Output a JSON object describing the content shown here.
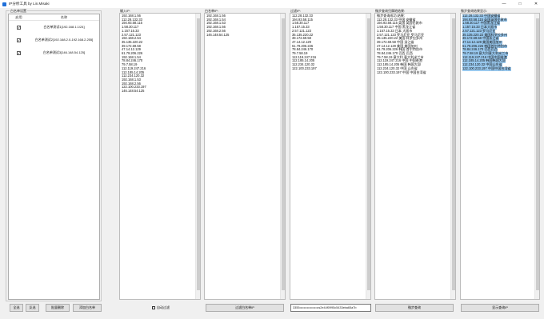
{
  "window": {
    "title": "IP分析工具 by Lin.Misaki",
    "controls": [
      "—",
      "□",
      "✕"
    ]
  },
  "whitelist": {
    "group_title": "白名单设置",
    "columns": [
      "启用",
      "名称"
    ],
    "rows": [
      {
        "checked": true,
        "name": "白名单测试1[192.168.1.1/24]"
      },
      {
        "checked": true,
        "name": "白名单测试2[192.168.2.0-192.168.2.255]"
      },
      {
        "checked": true,
        "name": "白名单测试3[146.148.54.125]"
      }
    ],
    "buttons": [
      "全选",
      "反选",
      "批量删除",
      "添加白名单"
    ]
  },
  "input_panel": {
    "label": "输入IP:",
    "lines": [
      "192.168.1.56",
      "112.28.132.33",
      "194.93.58.115",
      "1.58.30.117",
      "1.157.15.33",
      "2.57.121.123",
      "192.168.2.54",
      "35.135.220.22",
      "39.172.69.58",
      "47.14.12.129",
      "61.79.206.226",
      "192.168.1.54",
      "78.84.246.170",
      "79.7.58.19",
      "112.119.247.216",
      "112.185.14.205",
      "112.234.120.32",
      "192.168.1.53",
      "192.168.2.56",
      "122.100.233.197",
      "146.148.54.125"
    ]
  },
  "whitelisted_panel": {
    "label": "白名单IP:",
    "lines": [
      "192.168.1.56",
      "192.168.1.54",
      "192.168.1.53",
      "192.168.1.56",
      "192.168.2.56",
      "146.148.54.125"
    ]
  },
  "filtered_panel": {
    "label": "过滤IP:",
    "lines": [
      "112.28.132.33",
      "194.93.58.115",
      "1.58.30.117",
      "1.157.15.33",
      "2.57.121.123",
      "35.135.220.22",
      "39.172.69.58",
      "47.14.12.129",
      "61.79.206.226",
      "78.84.246.170",
      "79.7.58.19",
      "112.119.247.216",
      "112.185.14.205",
      "112.234.120.32",
      "122.100.233.197"
    ]
  },
  "weibu_panel": {
    "label": "微步查询归属地结果:",
    "lines": [
      "微步查询成功,结果:",
      "112.28.132.33 中国 安徽省",
      "194.93.58.115 英国 英国伦敦市",
      "1.58.30.117 中国 黑龙江省",
      "1.157.15.33 日本 大阪市",
      "2.57.121.123 罗马尼亚 罗马尼亚",
      "35.135.220.22 美国 科罗拉多州",
      "39.172.69.58 中国 浙江省",
      "47.14.12.129 美国 美国加州",
      "61.79.206.226 韩国 首尔特别市",
      "78.84.246.170 巴西 巴西",
      "79.7.58.19 意大利 意大利米兰市",
      "112.119.247.216 中国 中国香港",
      "112.185.14.205 韩国 韩国大邱",
      "112.234.120.32 中国 山东省",
      "122.100.233.197 中国 中国台湾省"
    ]
  },
  "result_panel": {
    "label": "微步查询结果显示:",
    "lines": [
      "112.28.132.33 中国安徽省",
      "194.93.58.115 英国英国伦敦市",
      "1.58.30.117 中国黑龙江省",
      "1.157.15.33 日本大阪市",
      "2.57.121.123 罗马尼亚",
      "35.135.220.22 美国科罗拉多州",
      "39.172.69.58 中国浙江省",
      "47.14.12.129 美国美国加州",
      "61.79.206.226 韩国首尔特别市",
      "78.84.246.170 巴西巴西",
      "79.7.58.19 意大利意大利米兰市",
      "112.119.247.216 中国中国香港",
      "112.185.14.205 韩国韩国大邱",
      "112.234.120.32 中国山东省",
      "122.100.233.197 中国中国台湾省"
    ]
  },
  "controls": {
    "auto_filter_label": "自动过滤",
    "filter_button": "过滤白名单IP",
    "apikey_value": "3355••••••••••••••••••s2e44f0995c5433eba65a7b",
    "query_button": "微步查询",
    "display_button": "显示查询IP"
  }
}
